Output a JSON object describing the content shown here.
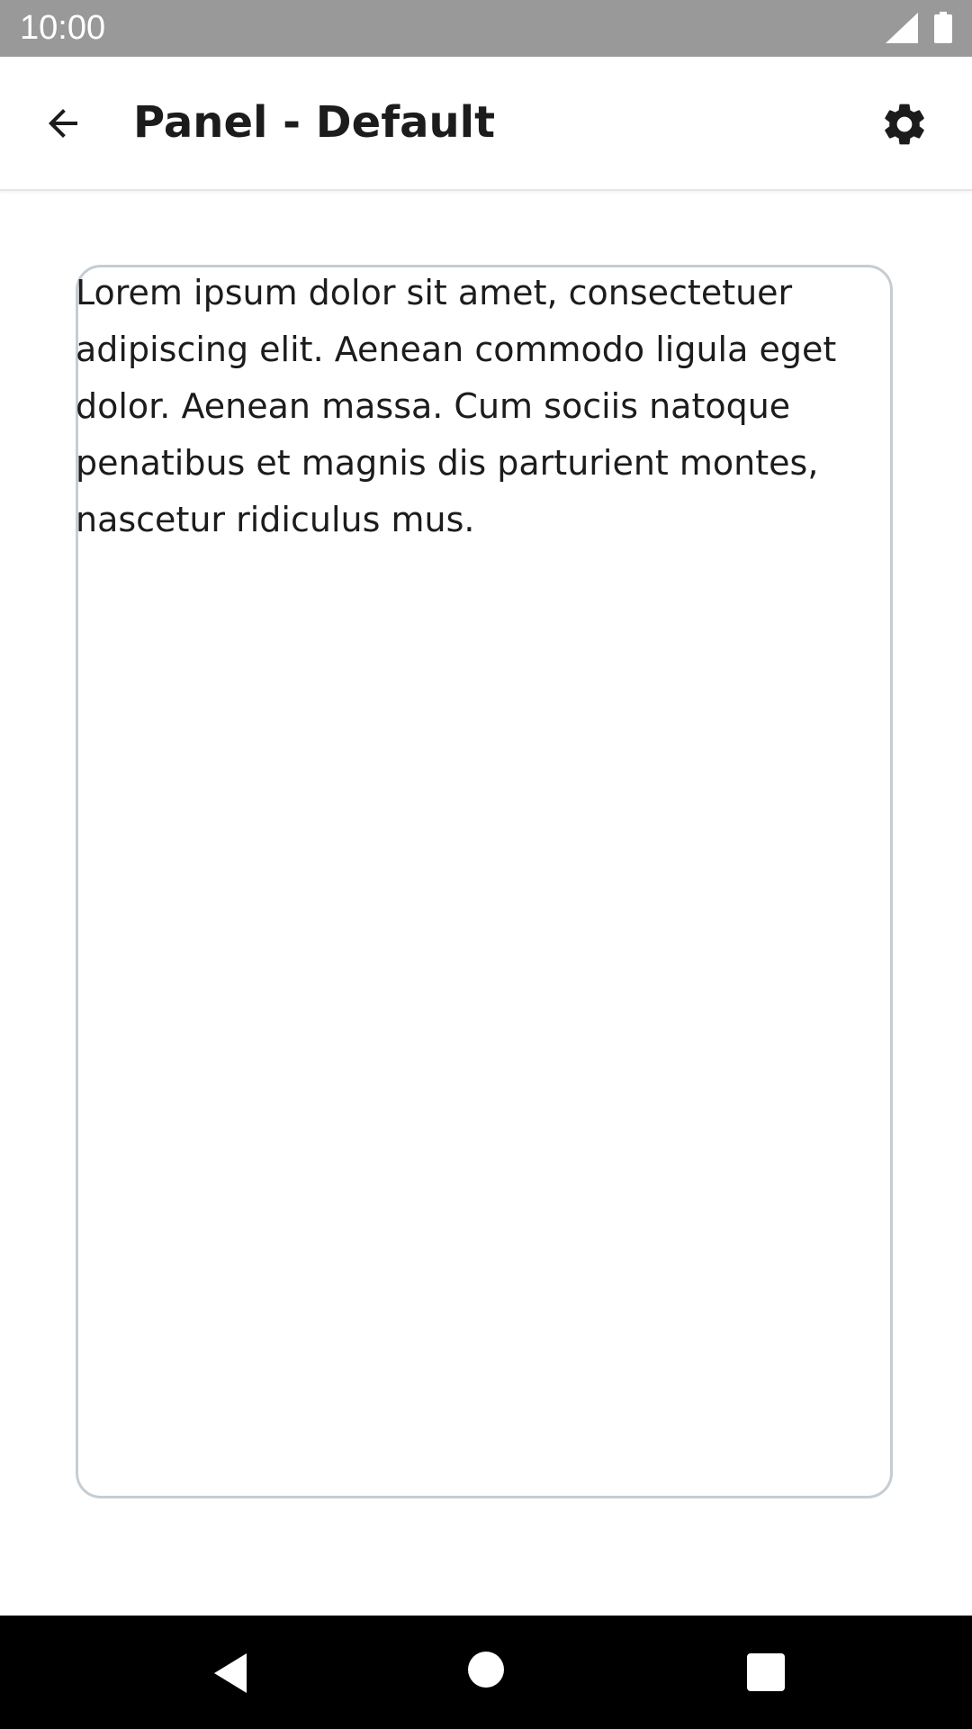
{
  "status_bar": {
    "time": "10:00",
    "icons": [
      "signal-icon",
      "battery-icon"
    ]
  },
  "app_bar": {
    "title": "Panel - Default",
    "back_icon": "arrow-back-icon",
    "settings_icon": "gear-icon"
  },
  "panel": {
    "text": "Lorem ipsum dolor sit amet, consectetuer adipiscing elit. Aenean commodo ligula eget dolor. Aenean massa. Cum sociis natoque penatibus et magnis dis parturient montes, nascetur ridiculus mus.",
    "border_color": "#c5cdd3"
  },
  "nav_bar": {
    "icons": [
      "nav-back-icon",
      "nav-home-icon",
      "nav-recents-icon"
    ]
  },
  "colors": {
    "status_bar": "#999999",
    "text": "#1c1c1c",
    "nav_bar": "#000000"
  }
}
